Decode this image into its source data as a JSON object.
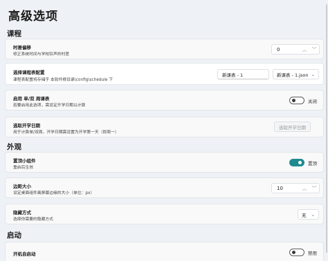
{
  "page": {
    "title": "高级选项"
  },
  "sections": {
    "course": "课程",
    "appearance": "外观",
    "startup": "启动"
  },
  "time_offset": {
    "title": "时差偏移",
    "desc": "修正系统时间与学校铃声的时差",
    "value": "0"
  },
  "schedule": {
    "title": "选择课程表配置",
    "desc": "课程表配置将存储于 本软件根目录\\config\\schedule 下",
    "input_value": "新课表 - 1",
    "selected_file": "新课表 - 1.json"
  },
  "week_mode": {
    "title": "启用 单/双 周课表",
    "desc": "若要启用此选项，需设定开学日期以计算",
    "state_label": "关闭"
  },
  "start_date": {
    "title": "选取开学日期",
    "desc": "用于计算单/双周，开学日期需设置为开学第一天（即周一）",
    "button_label": "选取开学日期"
  },
  "pin_widget": {
    "title": "置顶小组件",
    "desc": "重启后生效",
    "state_label": "置顶"
  },
  "margin": {
    "title": "边距大小",
    "desc": "设定桌面组件离屏幕边缘的大小（单位：px）",
    "value": "10"
  },
  "hide_mode": {
    "title": "隐藏方式",
    "desc": "选择你需要的隐藏方式",
    "selected": "无"
  },
  "autostart": {
    "title": "开机自启动",
    "state_label": "禁用"
  },
  "colors": {
    "accent": "#1f8a8f"
  }
}
